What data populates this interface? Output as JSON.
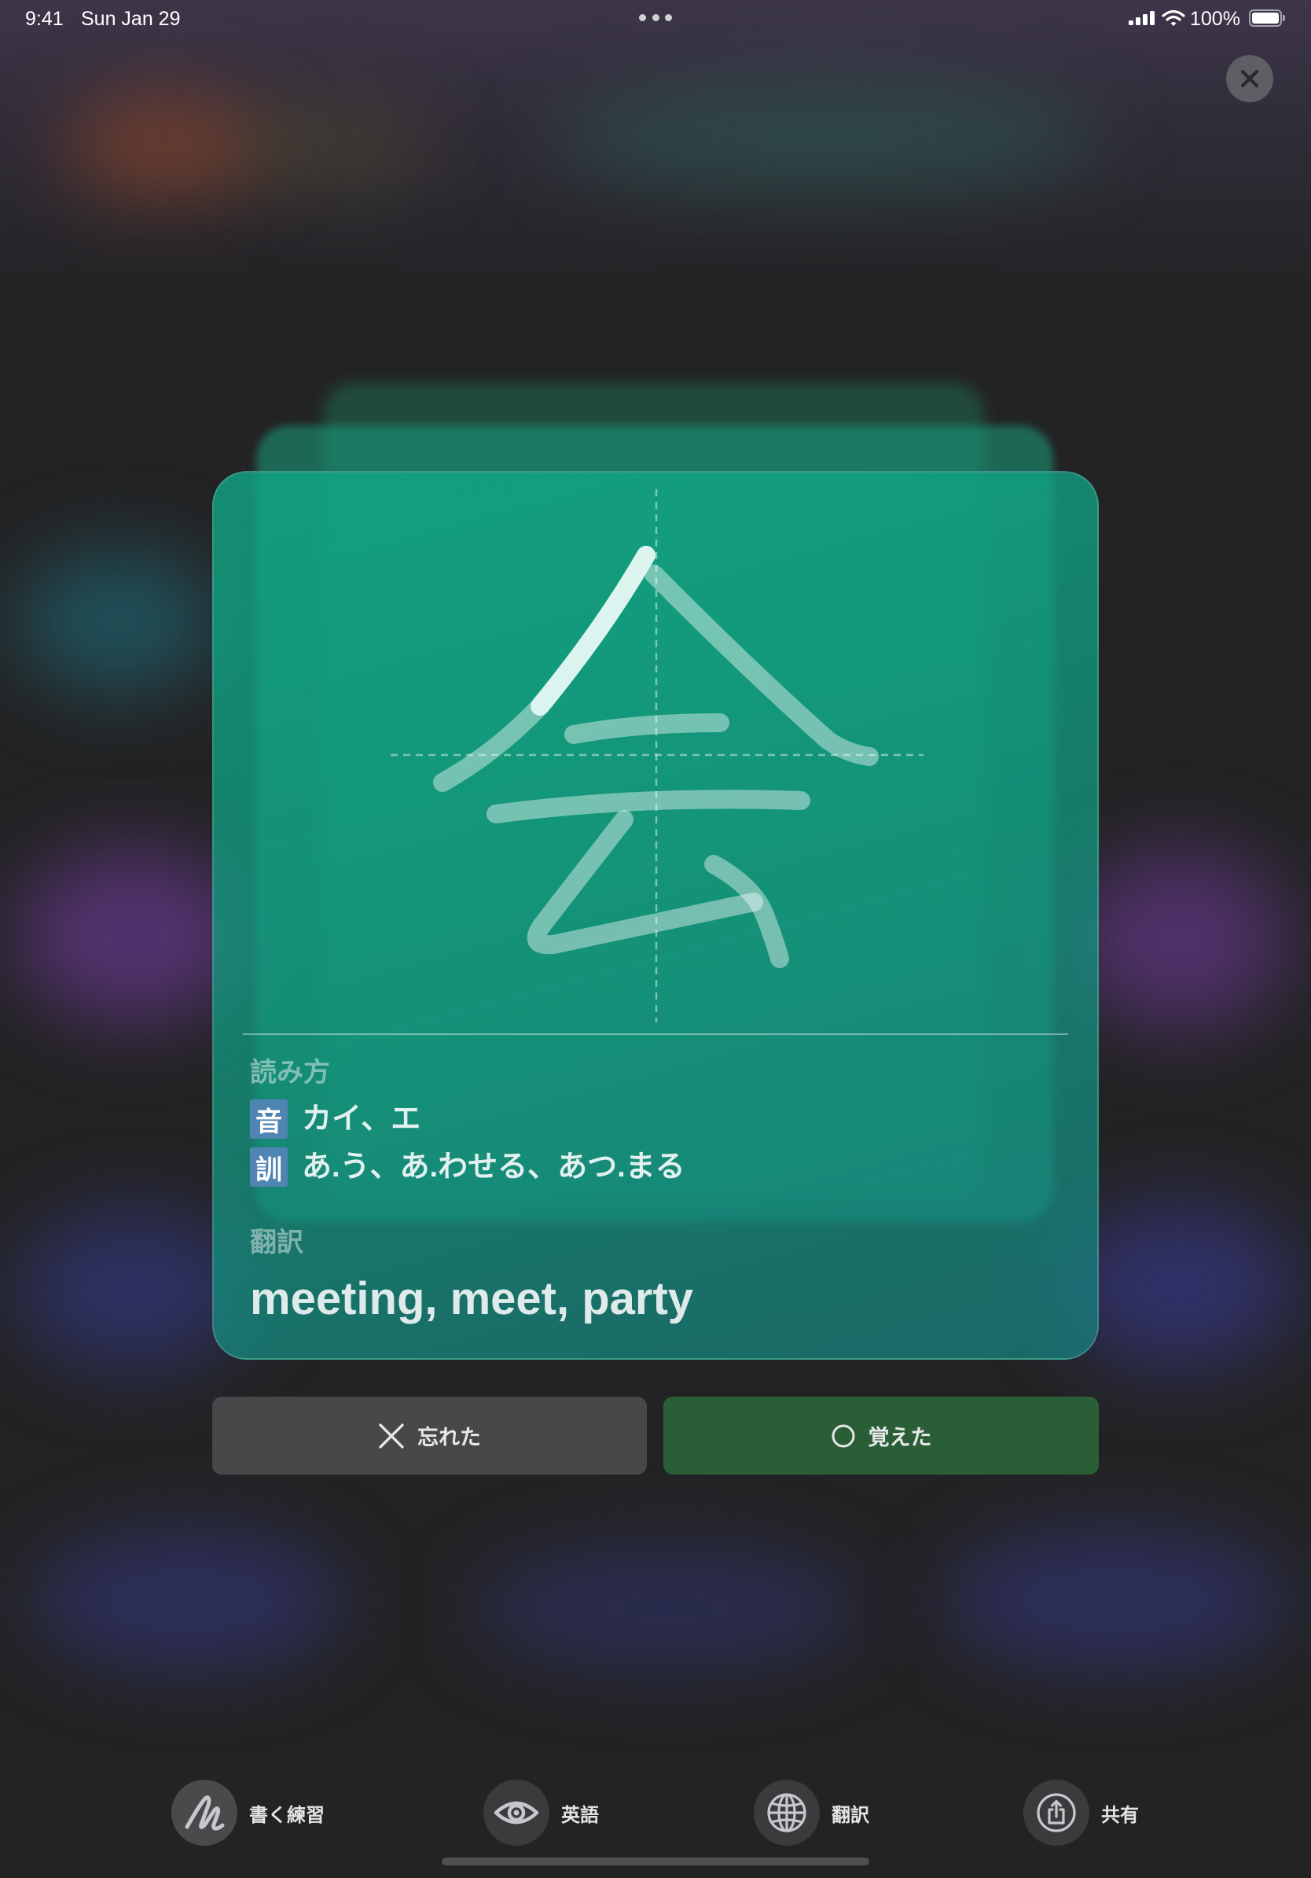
{
  "status_bar": {
    "time": "9:41",
    "date": "Sun Jan 29",
    "battery_percent": "100%",
    "icons": [
      "multitasking-dots-icon",
      "cellular-signal-icon",
      "wifi-icon",
      "battery-icon"
    ]
  },
  "close_button": {
    "icon": "close-icon"
  },
  "card": {
    "reading_label": "読み方",
    "on_badge": "音",
    "on_reading": "カイ、エ",
    "kun_badge": "訓",
    "kun_reading": "あ.う、あ.わせる、あつ.まる",
    "translation_label": "翻訳",
    "translation": "meeting, meet, party"
  },
  "actions": {
    "forgot": {
      "label": "忘れた",
      "icon": "x-icon"
    },
    "remembered": {
      "label": "覚えた",
      "icon": "circle-icon"
    }
  },
  "toolbar": {
    "items": [
      {
        "label": "書く練習",
        "icon": "handwriting-icon"
      },
      {
        "label": "英語",
        "icon": "eye-icon"
      },
      {
        "label": "翻訳",
        "icon": "globe-icon"
      },
      {
        "label": "共有",
        "icon": "share-icon"
      }
    ]
  },
  "colors": {
    "badge": "#4f84b3",
    "forgot_button": "#48484a",
    "remembered_button": "#2a5e37"
  }
}
